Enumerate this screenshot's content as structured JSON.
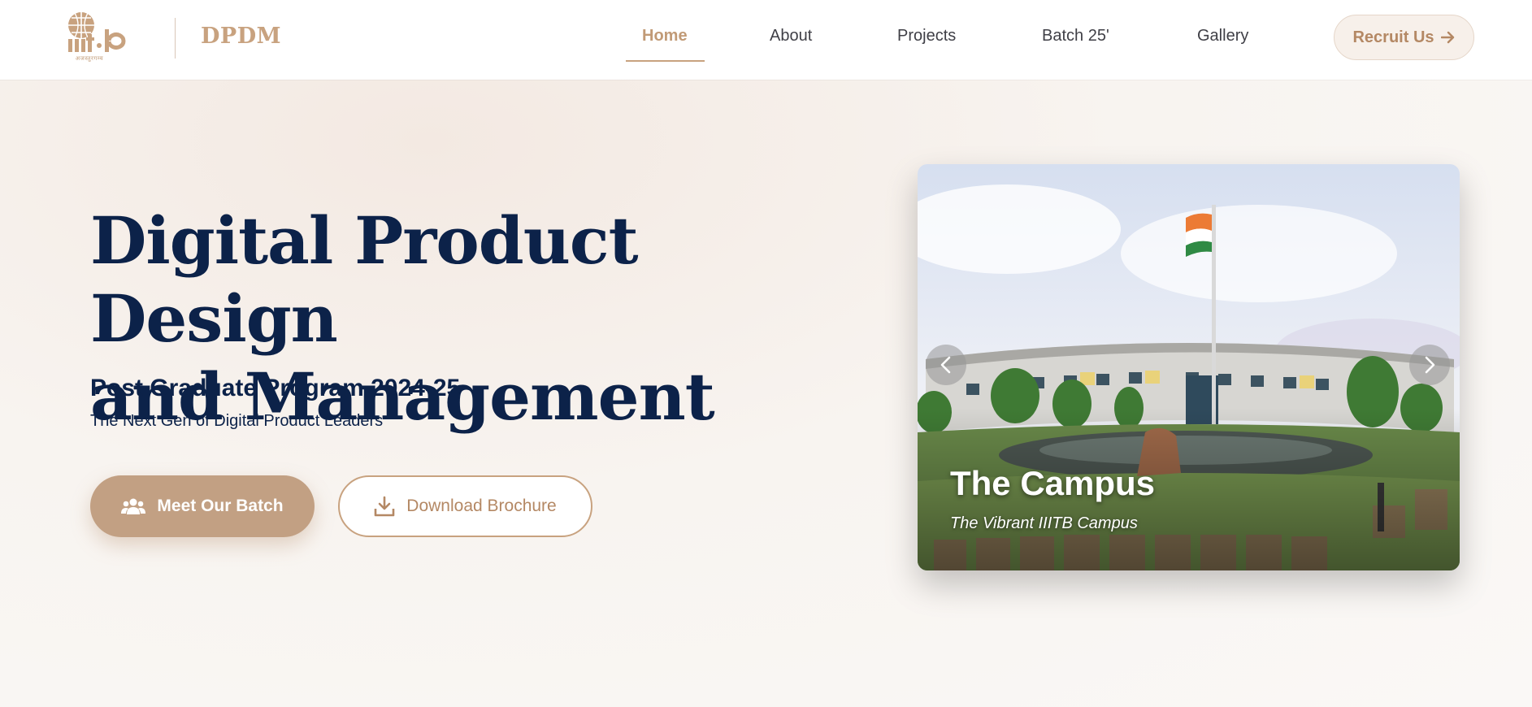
{
  "header": {
    "logo_text": "iiitb",
    "logo_subtext": "अजस्तुरगम्य",
    "brand": "DPDM",
    "nav": [
      {
        "label": "Home",
        "active": true
      },
      {
        "label": "About",
        "active": false
      },
      {
        "label": "Projects",
        "active": false
      },
      {
        "label": "Batch 25'",
        "active": false
      },
      {
        "label": "Gallery",
        "active": false
      }
    ],
    "cta_label": "Recruit Us"
  },
  "hero": {
    "title_line1": "Digital Product Design",
    "title_line2": "and Management",
    "subtitle": "Post Graduate Program 2024-25",
    "tagline": "The Next Gen of Digital Product Leaders",
    "primary_button": "Meet Our Batch",
    "secondary_button": "Download Brochure"
  },
  "carousel": {
    "slide_title": "The Campus",
    "slide_subtitle": "The Vibrant IIITB Campus"
  },
  "colors": {
    "accent": "#c2a083",
    "navy": "#0c2249",
    "background": "#f8f4f0"
  },
  "icons": {
    "primary_button": "users-icon",
    "secondary_button": "download-icon",
    "cta": "arrow-right-icon",
    "prev": "chevron-left-icon",
    "next": "chevron-right-icon"
  }
}
